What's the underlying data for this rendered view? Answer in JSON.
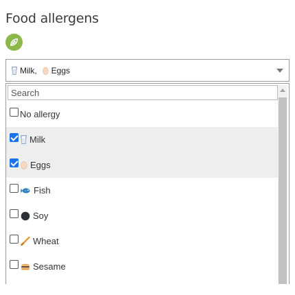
{
  "title": "Food allergens",
  "filter_icon": "leaf-icon",
  "accent_color": "#8cb84a",
  "check_color": "#1a73e8",
  "selection": {
    "items": [
      {
        "icon": "milk-glass-icon",
        "label": "Milk"
      },
      {
        "icon": "egg-icon",
        "label": "Eggs"
      }
    ],
    "separator": ","
  },
  "search": {
    "placeholder": "Search",
    "value": ""
  },
  "options": [
    {
      "label": "No allergy",
      "icon": "",
      "checked": false
    },
    {
      "label": "Milk",
      "icon": "milk-glass-icon",
      "checked": true
    },
    {
      "label": "Eggs",
      "icon": "egg-icon",
      "checked": true
    },
    {
      "label": "Fish",
      "icon": "fish-icon",
      "checked": false
    },
    {
      "label": "Soy",
      "icon": "soy-bean-icon",
      "checked": false
    },
    {
      "label": "Wheat",
      "icon": "wheat-icon",
      "checked": false
    },
    {
      "label": "Sesame",
      "icon": "sesame-bun-icon",
      "checked": false
    }
  ]
}
